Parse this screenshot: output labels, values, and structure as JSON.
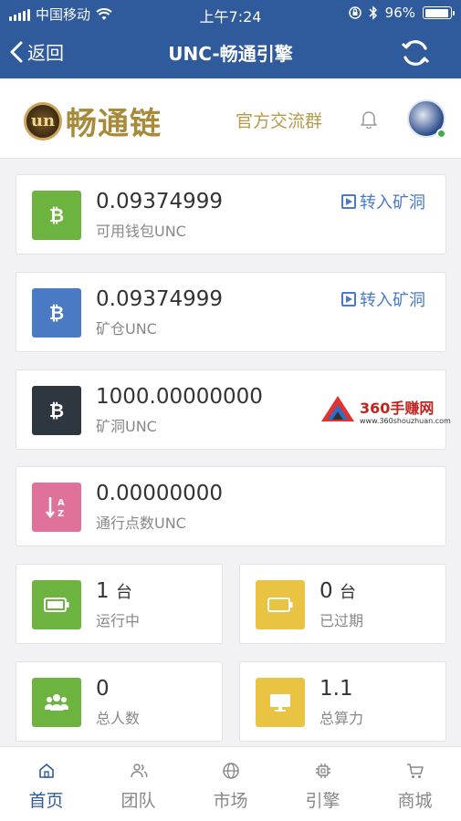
{
  "status_bar": {
    "carrier": "中国移动",
    "time": "上午7:24",
    "battery_percent": "96%",
    "battery_level": 0.96
  },
  "nav": {
    "back_label": "返回",
    "title": "UNC-畅通引擎",
    "refresh_icon": "refresh-icon"
  },
  "brand": {
    "logo_mark": "un",
    "logo_text": "畅通链",
    "group_link": "官方交流群"
  },
  "cards": [
    {
      "value": "0.09374999",
      "label": "可用钱包UNC",
      "action": "转入矿洞",
      "color": "#6db33f",
      "icon": "bitcoin-icon"
    },
    {
      "value": "0.09374999",
      "label": "矿仓UNC",
      "action": "转入矿洞",
      "color": "#4a7ac4",
      "icon": "bitcoin-icon"
    },
    {
      "value": "1000.00000000",
      "label": "矿洞UNC",
      "color": "#2e3640",
      "icon": "bitcoin-icon"
    },
    {
      "value": "0.00000000",
      "label": "通行点数UNC",
      "color": "#e0719b",
      "icon": "sort-az-icon"
    }
  ],
  "stats": [
    {
      "value": "1",
      "unit": "台",
      "label": "运行中",
      "color": "#6db33f",
      "icon": "battery-full-icon"
    },
    {
      "value": "0",
      "unit": "台",
      "label": "已过期",
      "color": "#e8c442",
      "icon": "battery-empty-icon"
    },
    {
      "value": "0",
      "label": "总人数",
      "color": "#6db33f",
      "icon": "users-icon"
    },
    {
      "value": "1.1",
      "label": "总算力",
      "color": "#e8c442",
      "icon": "monitor-icon"
    }
  ],
  "watermark": {
    "title": "360手赚网",
    "url": "www.360shouzhuan.com"
  },
  "tabs": [
    {
      "label": "首页",
      "icon": "home-icon",
      "active": true
    },
    {
      "label": "团队",
      "icon": "team-icon",
      "active": false
    },
    {
      "label": "市场",
      "icon": "globe-icon",
      "active": false
    },
    {
      "label": "引擎",
      "icon": "chip-icon",
      "active": false
    },
    {
      "label": "商城",
      "icon": "cart-icon",
      "active": false
    }
  ]
}
